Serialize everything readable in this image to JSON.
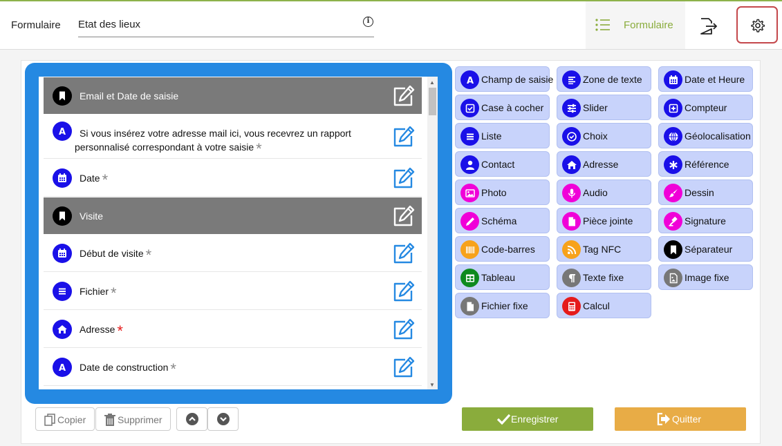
{
  "header": {
    "form_label": "Formulaire",
    "title_value": "Etat des lieux",
    "info_icon": "info-icon",
    "nav_formulaire_label": "Formulaire",
    "list_icon": "list-icon",
    "logout_icon": "logout-icon",
    "settings_icon": "gear-icon"
  },
  "colors": {
    "accent_green": "#8aac3c",
    "frame_blue": "#2589e2",
    "field_icon_blue": "#1a10e8",
    "section_grey": "#7a7a7a",
    "palette_bg": "#c8d3fb",
    "save_green": "#8aac3c",
    "quit_orange": "#e8ac46",
    "required_red": "#e51b1b",
    "settings_border": "#c4474b"
  },
  "fields": [
    {
      "type": "section",
      "icon": "bookmark-icon",
      "label": "Email et Date de saisie",
      "star": ""
    },
    {
      "type": "field",
      "icon": "text-a-icon",
      "label": "Si vous insérez votre adresse mail ici, vous recevrez un rapport personnalisé correspondant à votre saisie",
      "star": "*"
    },
    {
      "type": "field",
      "icon": "calendar-icon",
      "label": "Date",
      "star": "*"
    },
    {
      "type": "section",
      "icon": "bookmark-icon",
      "label": "Visite",
      "star": ""
    },
    {
      "type": "field",
      "icon": "calendar-icon",
      "label": "Début de visite",
      "star": "*"
    },
    {
      "type": "field",
      "icon": "list-icon",
      "label": "Fichier",
      "star": "*"
    },
    {
      "type": "field",
      "icon": "home-icon",
      "label": "Adresse",
      "star": "*",
      "required": true
    },
    {
      "type": "field",
      "icon": "text-a-icon",
      "label": "Date de construction",
      "star": "*"
    }
  ],
  "palette": [
    {
      "label": "Champ de saisie",
      "icon": "text-a-icon",
      "color": "#1a10e8"
    },
    {
      "label": "Zone de texte",
      "icon": "text-lines-icon",
      "color": "#1a10e8"
    },
    {
      "label": "Date et Heure",
      "icon": "calendar-icon",
      "color": "#1a10e8"
    },
    {
      "label": "Case à cocher",
      "icon": "checkbox-icon",
      "color": "#1a10e8"
    },
    {
      "label": "Slider",
      "icon": "sliders-icon",
      "color": "#1a10e8"
    },
    {
      "label": "Compteur",
      "icon": "plus-square-icon",
      "color": "#1a10e8"
    },
    {
      "label": "Liste",
      "icon": "list-icon",
      "color": "#1a10e8"
    },
    {
      "label": "Choix",
      "icon": "check-circle-icon",
      "color": "#1a10e8"
    },
    {
      "label": "Géolocalisation",
      "icon": "globe-icon",
      "color": "#1a10e8"
    },
    {
      "label": "Contact",
      "icon": "user-icon",
      "color": "#1a10e8"
    },
    {
      "label": "Adresse",
      "icon": "home-icon",
      "color": "#1a10e8"
    },
    {
      "label": "Référence",
      "icon": "asterisk-icon",
      "color": "#1a10e8"
    },
    {
      "label": "Photo",
      "icon": "image-icon",
      "color": "#f000d8"
    },
    {
      "label": "Audio",
      "icon": "microphone-icon",
      "color": "#f000d8"
    },
    {
      "label": "Dessin",
      "icon": "brush-icon",
      "color": "#f000d8"
    },
    {
      "label": "Schéma",
      "icon": "pencil-icon",
      "color": "#f000d8"
    },
    {
      "label": "Pièce jointe",
      "icon": "file-icon",
      "color": "#f000d8"
    },
    {
      "label": "Signature",
      "icon": "gavel-icon",
      "color": "#f000d8"
    },
    {
      "label": "Code-barres",
      "icon": "barcode-icon",
      "color": "#f7a21b"
    },
    {
      "label": "Tag NFC",
      "icon": "rss-icon",
      "color": "#f7a21b"
    },
    {
      "label": "Séparateur",
      "icon": "bookmark-icon",
      "color": "#000000"
    },
    {
      "label": "Tableau",
      "icon": "table-icon",
      "color": "#0f8a1f"
    },
    {
      "label": "Texte fixe",
      "icon": "paragraph-icon",
      "color": "#777777"
    },
    {
      "label": "Image fixe",
      "icon": "image-file-icon",
      "color": "#777777"
    },
    {
      "label": "Fichier fixe",
      "icon": "file-icon",
      "color": "#777777"
    },
    {
      "label": "Calcul",
      "icon": "calculator-icon",
      "color": "#e51b1b"
    }
  ],
  "actions": {
    "copy_label": "Copier",
    "delete_label": "Supprimer",
    "move_up_icon": "chevron-up-icon",
    "move_down_icon": "chevron-down-icon",
    "save_label": "Enregistrer",
    "quit_label": "Quitter"
  }
}
